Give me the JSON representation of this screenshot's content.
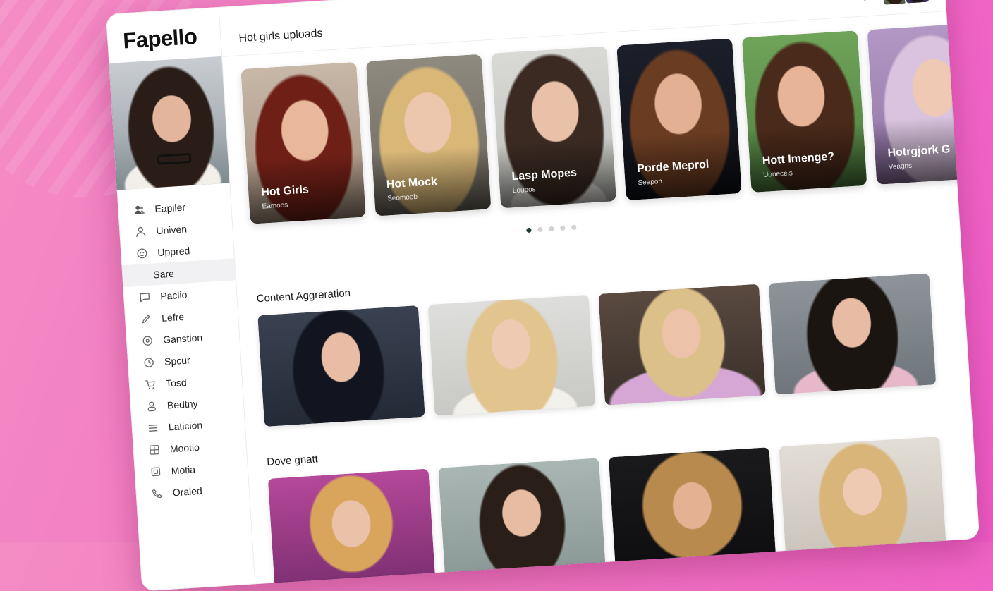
{
  "app": {
    "logo": "Fapello"
  },
  "header": {
    "title": "Hot girls uploads"
  },
  "sidebar": {
    "items": [
      {
        "label": "Eapiler",
        "icon": "users-icon"
      },
      {
        "label": "Univen",
        "icon": "user-icon"
      },
      {
        "label": "Uppred",
        "icon": "smiley-icon"
      },
      {
        "label": "Sare",
        "icon": "",
        "selected": true
      },
      {
        "label": "Paclio",
        "icon": "chat-icon"
      },
      {
        "label": "Lefre",
        "icon": "pen-icon"
      },
      {
        "label": "Ganstion",
        "icon": "circle-icon"
      },
      {
        "label": "Spcur",
        "icon": "clock-icon"
      },
      {
        "label": "Tosd",
        "icon": "cart-icon"
      },
      {
        "label": "Bedtny",
        "icon": "person-icon"
      },
      {
        "label": "Laticion",
        "icon": "list-icon"
      },
      {
        "label": "Mootio",
        "icon": "grid-icon"
      },
      {
        "label": "Motia",
        "icon": "square-icon"
      },
      {
        "label": "Oraled",
        "icon": "phone-icon"
      }
    ]
  },
  "carousel": {
    "cards": [
      {
        "title": "Hot Girls",
        "subtitle": "Eamoos"
      },
      {
        "title": "Hot Mock",
        "subtitle": "Seomoob"
      },
      {
        "title": "Lasp Mopes",
        "subtitle": "Loupos"
      },
      {
        "title": "Porde Meprol",
        "subtitle": "Seapon"
      },
      {
        "title": "Hott Imenge?",
        "subtitle": "Uonecels"
      },
      {
        "title": "Hotrgjork G",
        "subtitle": "Veagns"
      }
    ],
    "active_dot": 1,
    "dot_count": 5
  },
  "sections": {
    "content_aggregation": {
      "title": "Content Aggreration"
    },
    "dove_gnatt": {
      "title": "Dove gnatt"
    }
  },
  "colors": {
    "accent": "#1e3d3a",
    "background": "#f277c3"
  }
}
